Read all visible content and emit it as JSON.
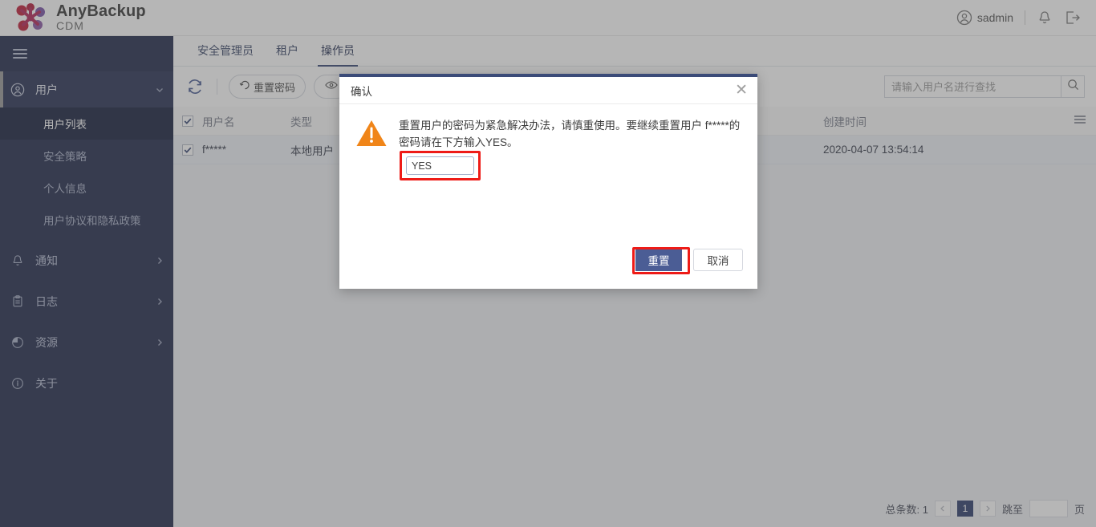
{
  "header": {
    "brand_name": "AnyBackup",
    "brand_sub": "CDM",
    "logo_icon": "molecule-logo-icon",
    "username": "sadmin",
    "user_icon": "user-circle-icon",
    "notification_icon": "bell-icon",
    "logout_icon": "logout-icon"
  },
  "sidebar": {
    "menu_icon": "hamburger-icon",
    "groups": [
      {
        "label": "用户",
        "icon": "user-circle-icon",
        "arrow": "chevron-down-icon",
        "expanded": true,
        "active": true,
        "children": [
          {
            "label": "用户列表",
            "selected": true
          },
          {
            "label": "安全策略",
            "selected": false
          },
          {
            "label": "个人信息",
            "selected": false
          },
          {
            "label": "用户协议和隐私政策",
            "selected": false
          }
        ]
      },
      {
        "label": "通知",
        "icon": "bell-icon",
        "arrow": "chevron-right-icon",
        "expanded": false,
        "active": false,
        "children": []
      },
      {
        "label": "日志",
        "icon": "clipboard-icon",
        "arrow": "chevron-right-icon",
        "expanded": false,
        "active": false,
        "children": []
      },
      {
        "label": "资源",
        "icon": "pie-chart-icon",
        "arrow": "chevron-right-icon",
        "expanded": false,
        "active": false,
        "children": []
      },
      {
        "label": "关于",
        "icon": "info-circle-icon",
        "arrow": "",
        "expanded": false,
        "active": false,
        "children": []
      }
    ]
  },
  "tabs": [
    {
      "label": "安全管理员",
      "active": false
    },
    {
      "label": "租户",
      "active": false
    },
    {
      "label": "操作员",
      "active": true
    }
  ],
  "toolbar": {
    "refresh_icon": "refresh-icon",
    "reset_password_label": "重置密码",
    "reset_password_icon": "undo-icon",
    "view_icon": "eye-icon",
    "search_placeholder": "请输入用户名进行查找",
    "search_value": "",
    "search_icon": "search-icon",
    "column_menu_icon": "hamburger-menu-icon"
  },
  "table": {
    "columns": [
      "用户名",
      "类型",
      "创建时间"
    ],
    "header_checked": true,
    "rows": [
      {
        "checked": true,
        "username": "f*****",
        "type": "本地用户",
        "created": "2020-04-07 13:54:14"
      }
    ]
  },
  "pagination": {
    "total_label": "总条数: 1",
    "prev_icon": "chevron-left-icon",
    "current_page": "1",
    "next_icon": "chevron-right-icon",
    "jump_label": "跳至",
    "jump_value": "",
    "page_unit": "页"
  },
  "dialog": {
    "title": "确认",
    "close_icon": "close-icon",
    "warning_icon": "warning-triangle-icon",
    "message": "重置用户的密码为紧急解决办法，请慎重使用。要继续重置用户 f*****的密码请在下方输入YES。",
    "input_value": "YES",
    "confirm_label": "重置",
    "cancel_label": "取消"
  },
  "colors": {
    "sidebar_bg": "#252e4e",
    "sidebar_selected": "#1b2340",
    "accent": "#3b4b78",
    "primary_button": "#4b5d95",
    "warning": "#f08519",
    "highlight_box": "#ee1b17"
  }
}
